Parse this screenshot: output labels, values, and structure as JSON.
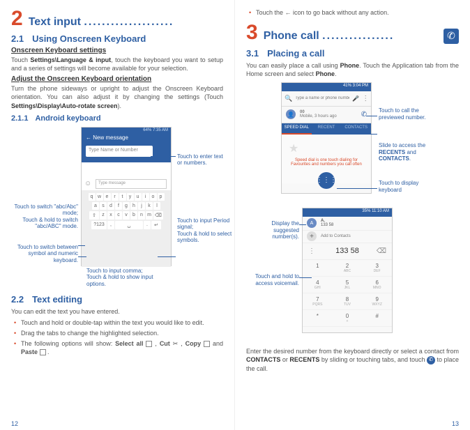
{
  "left": {
    "chapter_num": "2",
    "chapter_title": "Text input",
    "chapter_dots": "....................",
    "s21_num": "2.1",
    "s21_title": "Using Onscreen Keyboard",
    "h_osk_settings": "Onscreen Keyboard settings",
    "p_osk_settings_a": "Touch ",
    "p_osk_settings_b": "Settings\\Language & input",
    "p_osk_settings_c": ", touch the keyboard you want to setup and a series of settings will become available for your selection.",
    "h_adjust": "Adjust the Onscreen Keyboard orientation",
    "p_adjust_a": "Turn the phone sideways or upright to adjust the Onscreen Keyboard orientation. You can also adjust it by changing the settings (Touch ",
    "p_adjust_b": "Settings\\Display\\Auto-rotate screen",
    "p_adjust_c": ").",
    "s211_num": "2.1.1",
    "s211_title": "Android keyboard",
    "kb": {
      "status": "64% 7:35 AM",
      "header": "New message",
      "input_placeholder": "Type Name or Number",
      "msg_placeholder": "Type message",
      "row1": [
        "q",
        "w",
        "e",
        "r",
        "t",
        "y",
        "u",
        "i",
        "o",
        "p"
      ],
      "row2": [
        "a",
        "s",
        "d",
        "f",
        "g",
        "h",
        "j",
        "k",
        "l"
      ],
      "row3": [
        "⇧",
        "z",
        "x",
        "c",
        "v",
        "b",
        "n",
        "m",
        "⌫"
      ],
      "row4": [
        "?123",
        ",",
        "␣",
        ".",
        "↵"
      ]
    },
    "callouts": {
      "enter_text": "Touch to enter text or numbers.",
      "period_a": "Touch to input Period signal;",
      "period_b": "Touch & hold to select symbols.",
      "comma_a": "Touch to input comma;",
      "comma_b": "Touch & hold to show input options.",
      "abc_a": "Touch to switch \"abc/Abc\" mode;",
      "abc_b": "Touch & hold to switch \"abc/ABC\" mode.",
      "sym": "Touch to switch between symbol and numeric keyboard."
    },
    "s22_num": "2.2",
    "s22_title": "Text editing",
    "p_edit_intro": "You can edit the text you have entered.",
    "bul1": "Touch and hold or double-tap within the text you would like to edit.",
    "bul2": "Drag the tabs to change the highlighted selection.",
    "bul3_a": "The following options will show: ",
    "bul3_selectall": "Select all",
    "bul3_cut": "Cut",
    "bul3_copy": "Copy",
    "bul3_paste": "Paste",
    "page_num": "12"
  },
  "right": {
    "top_bul_a": "Touch the ",
    "top_bul_b": " icon to go back without any action.",
    "chapter_num": "3",
    "chapter_title": "Phone call",
    "chapter_dots": "................",
    "s31_num": "3.1",
    "s31_title": "Placing a call",
    "p_place_a": "You can easily place a call using ",
    "p_place_b": "Phone",
    "p_place_c": ". Touch the Application tab from the Home screen and select ",
    "p_place_d": "Phone",
    "p_place_e": ".",
    "ph1": {
      "status": "41% 3:04 PM",
      "search_placeholder": "Type a name or phone number",
      "recent_num": "00",
      "recent_sub": "Mobile, 3 hours ago",
      "tab1": "SPEED DIAL",
      "tab2": "RECENT",
      "tab3": "CONTACTS",
      "body_msg": "Speed dial is one touch dialing for Favourites and numbers you call often"
    },
    "callouts1": {
      "call_prev": "Touch to call the previewed number.",
      "slide_a": "Slide to access the ",
      "slide_b": "RECENTS",
      "slide_c": " and ",
      "slide_d": "CONTACTS",
      "slide_e": ".",
      "disp_kb": "Touch to display keyboard"
    },
    "ph2": {
      "status": "35% 11:10 AM",
      "sug_letter": "A",
      "sug_name": "A.",
      "sug_num": "133 58",
      "add": "Add to Contacts",
      "typed": "133 58",
      "pad": [
        {
          "n": "1",
          "s": ""
        },
        {
          "n": "2",
          "s": "ABC"
        },
        {
          "n": "3",
          "s": "DEF"
        },
        {
          "n": "4",
          "s": "GHI"
        },
        {
          "n": "5",
          "s": "JKL"
        },
        {
          "n": "6",
          "s": "MNO"
        },
        {
          "n": "7",
          "s": "PQRS"
        },
        {
          "n": "8",
          "s": "TUV"
        },
        {
          "n": "9",
          "s": "WXYZ"
        },
        {
          "n": "*",
          "s": ""
        },
        {
          "n": "0",
          "s": "+"
        },
        {
          "n": "#",
          "s": ""
        }
      ]
    },
    "callouts2": {
      "suggested": "Display the suggested number(s).",
      "voicemail": "Touch and hold to access voicemail."
    },
    "p_enter_a": "Enter the desired number from the keyboard directly or select a contact from ",
    "p_enter_b": "CONTACTS",
    "p_enter_c": " or ",
    "p_enter_d": "RECENTS",
    "p_enter_e": " by sliding or touching tabs, and touch ",
    "p_enter_f": " to place the call.",
    "page_num": "13"
  }
}
